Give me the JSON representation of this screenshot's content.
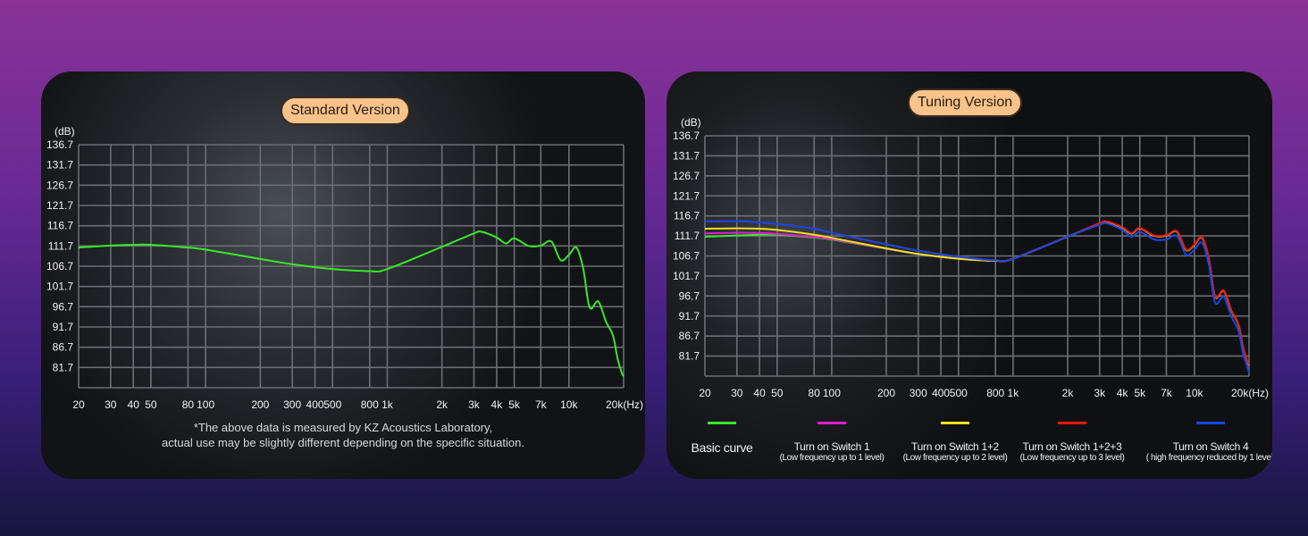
{
  "chart_data": [
    {
      "type": "line",
      "title": "Standard Version",
      "ylabel": "(dB)",
      "xlabel": "(Hz)",
      "x_scale": "log",
      "xlim": [
        20,
        20000
      ],
      "ylim": [
        76.7,
        136.7
      ],
      "grid": true,
      "y_ticks": [
        "136.7",
        "131.7",
        "126.7",
        "121.7",
        "116.7",
        "111.7",
        "106.7",
        "101.7",
        "96.7",
        "91.7",
        "86.7",
        "81.7"
      ],
      "x_ticks": [
        {
          "v": 20,
          "l": "20"
        },
        {
          "v": 30,
          "l": "30"
        },
        {
          "v": 40,
          "l": "40"
        },
        {
          "v": 50,
          "l": "50"
        },
        {
          "v": 80,
          "l": "80"
        },
        {
          "v": 100,
          "l": "100"
        },
        {
          "v": 200,
          "l": "200"
        },
        {
          "v": 300,
          "l": "300"
        },
        {
          "v": 400,
          "l": "400"
        },
        {
          "v": 500,
          "l": "500"
        },
        {
          "v": 800,
          "l": "800"
        },
        {
          "v": 1000,
          "l": "1k"
        },
        {
          "v": 2000,
          "l": "2k"
        },
        {
          "v": 3000,
          "l": "3k"
        },
        {
          "v": 4000,
          "l": "4k"
        },
        {
          "v": 5000,
          "l": "5k"
        },
        {
          "v": 7000,
          "l": "7k"
        },
        {
          "v": 10000,
          "l": "10k"
        },
        {
          "v": 20000,
          "l": "20k(Hz)"
        }
      ],
      "x": [
        20,
        30,
        40,
        50,
        80,
        100,
        200,
        300,
        500,
        800,
        1000,
        2000,
        3000,
        3300,
        4000,
        4500,
        5000,
        6000,
        7000,
        8000,
        9000,
        10000,
        11000,
        12000,
        13000,
        14500,
        16000,
        17500,
        18500,
        19500,
        20000
      ],
      "series": [
        {
          "color": "#39e82a",
          "values": [
            111.3,
            111.8,
            112.0,
            112.0,
            111.3,
            110.8,
            108.5,
            107.2,
            106.0,
            105.5,
            106.0,
            111.5,
            114.8,
            115.2,
            113.8,
            112.3,
            113.6,
            111.7,
            111.8,
            112.8,
            108.2,
            109.5,
            111.3,
            106.0,
            96.5,
            98.0,
            93.0,
            89.5,
            84.0,
            80.5,
            79.5
          ]
        }
      ],
      "footnote": [
        "*The above data is measured by KZ Acoustics Laboratory,",
        "actual use may be slightly different depending on the specific situation."
      ]
    },
    {
      "type": "line",
      "title": "Tuning Version",
      "ylabel": "(dB)",
      "xlabel": "(Hz)",
      "x_scale": "log",
      "xlim": [
        20,
        20000
      ],
      "ylim": [
        76.7,
        136.7
      ],
      "grid": true,
      "legend_position": "bottom",
      "y_ticks": [
        "136.7",
        "131.7",
        "126.7",
        "121.7",
        "116.7",
        "111.7",
        "106.7",
        "101.7",
        "96.7",
        "91.7",
        "86.7",
        "81.7"
      ],
      "x_ticks": [
        {
          "v": 20,
          "l": "20"
        },
        {
          "v": 30,
          "l": "30"
        },
        {
          "v": 40,
          "l": "40"
        },
        {
          "v": 50,
          "l": "50"
        },
        {
          "v": 80,
          "l": "80"
        },
        {
          "v": 100,
          "l": "100"
        },
        {
          "v": 200,
          "l": "200"
        },
        {
          "v": 300,
          "l": "300"
        },
        {
          "v": 400,
          "l": "400"
        },
        {
          "v": 500,
          "l": "500"
        },
        {
          "v": 800,
          "l": "800"
        },
        {
          "v": 1000,
          "l": "1k"
        },
        {
          "v": 2000,
          "l": "2k"
        },
        {
          "v": 3000,
          "l": "3k"
        },
        {
          "v": 4000,
          "l": "4k"
        },
        {
          "v": 5000,
          "l": "5k"
        },
        {
          "v": 7000,
          "l": "7k"
        },
        {
          "v": 10000,
          "l": "10k"
        },
        {
          "v": 20000,
          "l": "20k(Hz)"
        }
      ],
      "x": [
        20,
        30,
        40,
        50,
        80,
        100,
        200,
        300,
        500,
        800,
        1000,
        2000,
        3000,
        3300,
        4000,
        4500,
        5000,
        6000,
        7000,
        8000,
        9000,
        10000,
        11000,
        12000,
        13000,
        14500,
        16000,
        17500,
        18500,
        19500,
        20000
      ],
      "series": [
        {
          "name": "Basic curve",
          "sub": "",
          "color": "#39e82a",
          "values": [
            111.5,
            111.8,
            112.0,
            112.0,
            111.3,
            110.8,
            108.5,
            107.2,
            106.0,
            105.5,
            106.0,
            111.5,
            114.8,
            115.2,
            113.8,
            112.3,
            113.6,
            111.7,
            111.8,
            112.8,
            108.2,
            109.5,
            111.3,
            106.0,
            96.5,
            98.0,
            93.0,
            89.5,
            84.0,
            80.5,
            79.5
          ]
        },
        {
          "name": "Turn on Switch 1",
          "sub": "(Low frequency up to 1 level)",
          "color": "#e21ccf",
          "values": [
            112.3,
            112.5,
            112.4,
            112.2,
            111.4,
            110.9,
            108.5,
            107.2,
            106.0,
            105.5,
            106.0,
            111.5,
            114.8,
            115.2,
            113.8,
            112.3,
            113.6,
            111.7,
            111.8,
            112.8,
            108.2,
            109.5,
            111.3,
            106.0,
            96.5,
            98.0,
            93.0,
            89.5,
            84.0,
            80.5,
            79.5
          ]
        },
        {
          "name": "Turn on Switch 1+2",
          "sub": "(Low frequency up to 2 level)",
          "color": "#f2e01e",
          "values": [
            113.5,
            113.6,
            113.5,
            113.2,
            112.0,
            111.2,
            108.6,
            107.2,
            106.0,
            105.5,
            106.0,
            111.5,
            114.8,
            115.2,
            113.8,
            112.3,
            113.6,
            111.7,
            111.8,
            112.8,
            108.2,
            109.5,
            111.3,
            106.0,
            96.5,
            98.0,
            93.0,
            89.5,
            84.0,
            80.5,
            79.5
          ]
        },
        {
          "name": "Turn on Switch 1+2+3",
          "sub": "(Low frequency up to 3 level)",
          "color": "#e8180e",
          "values": [
            115.3,
            115.4,
            115.1,
            114.7,
            113.5,
            112.5,
            109.6,
            108.0,
            106.5,
            105.6,
            106.0,
            111.5,
            114.9,
            115.3,
            113.9,
            112.4,
            113.7,
            111.8,
            111.9,
            112.9,
            108.3,
            109.6,
            111.4,
            106.1,
            96.6,
            98.1,
            93.1,
            89.6,
            84.1,
            80.6,
            79.6
          ]
        },
        {
          "name": "Turn on Switch 4",
          "sub": "( high frequency reduced by 1 level)",
          "color": "#1448e8",
          "values": [
            115.3,
            115.4,
            115.1,
            114.7,
            113.5,
            112.5,
            109.6,
            108.0,
            106.5,
            105.6,
            106.0,
            111.5,
            114.5,
            114.8,
            113.2,
            111.5,
            112.7,
            110.8,
            110.8,
            111.7,
            107.0,
            108.3,
            110.0,
            104.6,
            95.0,
            96.5,
            91.5,
            88.0,
            82.6,
            79.2,
            77.5
          ]
        }
      ]
    }
  ]
}
